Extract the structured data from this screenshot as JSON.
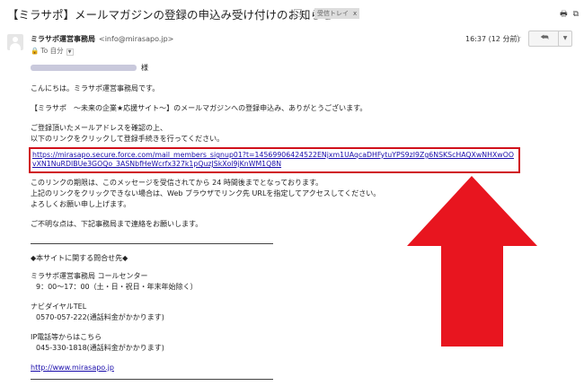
{
  "subject": "【ミラサポ】メールマガジンの登録の申込み受け付けのお知らせ",
  "label_chip": "受信トレイ",
  "label_chip_close": "x",
  "sender": {
    "name": "ミラサポ運営事務局",
    "email": "<info@mirasapo.jp>",
    "to_prefix": "To",
    "to_name": "自分",
    "time": "16:37 (12 分前)"
  },
  "body": {
    "salutation_suffix": "様",
    "greeting": "こんにちは。ミラサポ運営事務局です。",
    "thanks": "【ミラサポ　～未来の企業★応援サイト～】のメールマガジンへの登録申込み、ありがとうございます。",
    "confirm_1": "ご登録頂いたメールアドレスを確認の上、",
    "confirm_2": "以下のリンクをクリックして登録手続きを行ってください。",
    "signup_link": "https://mirasapo.secure.force.com/mail_members_signup01?t=14569906424522ENjxm1UAqcaDHFytuYPS9zI9Zg6NSKScHAQXwNHXwOOvXN1NuRDIBUe3GOQo_3ASNbfHeWcrfx327k1pQuzJSkXol9jKnWM1Q8N",
    "expiry_1": "このリンクの期限は、このメッセージを受信されてから 24 時間後までとなっております。",
    "expiry_2": "上記のリンクをクリックできない場合は、Web ブラウザでリンク先 URLを指定してアクセスしてください。",
    "expiry_3": "よろしくお願い申し上げます。",
    "contact_note": "ご不明な点は、下記事務局まで連絡をお願いします。",
    "inquiry_heading": "◆本サイトに関する問合せ先◆",
    "center_name": "ミラサポ運営事務局 コールセンター",
    "hours": "9：00～17：00（土・日・祝日・年末年始除く）",
    "navi_label": "ナビダイヤルTEL",
    "navi_number": "0570-057-222(通話料金がかかります)",
    "ip_label": "IP電話等からはこちら",
    "ip_number": "045-330-1818(通話料金がかかります)",
    "site_url": "http://www.mirasapo.jp"
  },
  "colors": {
    "highlight": "#d0111b",
    "arrow": "#e8151f",
    "link": "#1a0dab"
  },
  "icons": [
    "important-marker-icon",
    "print-icon",
    "new-window-icon",
    "star-icon",
    "reply-icon",
    "more-caret-icon",
    "lock-icon"
  ]
}
